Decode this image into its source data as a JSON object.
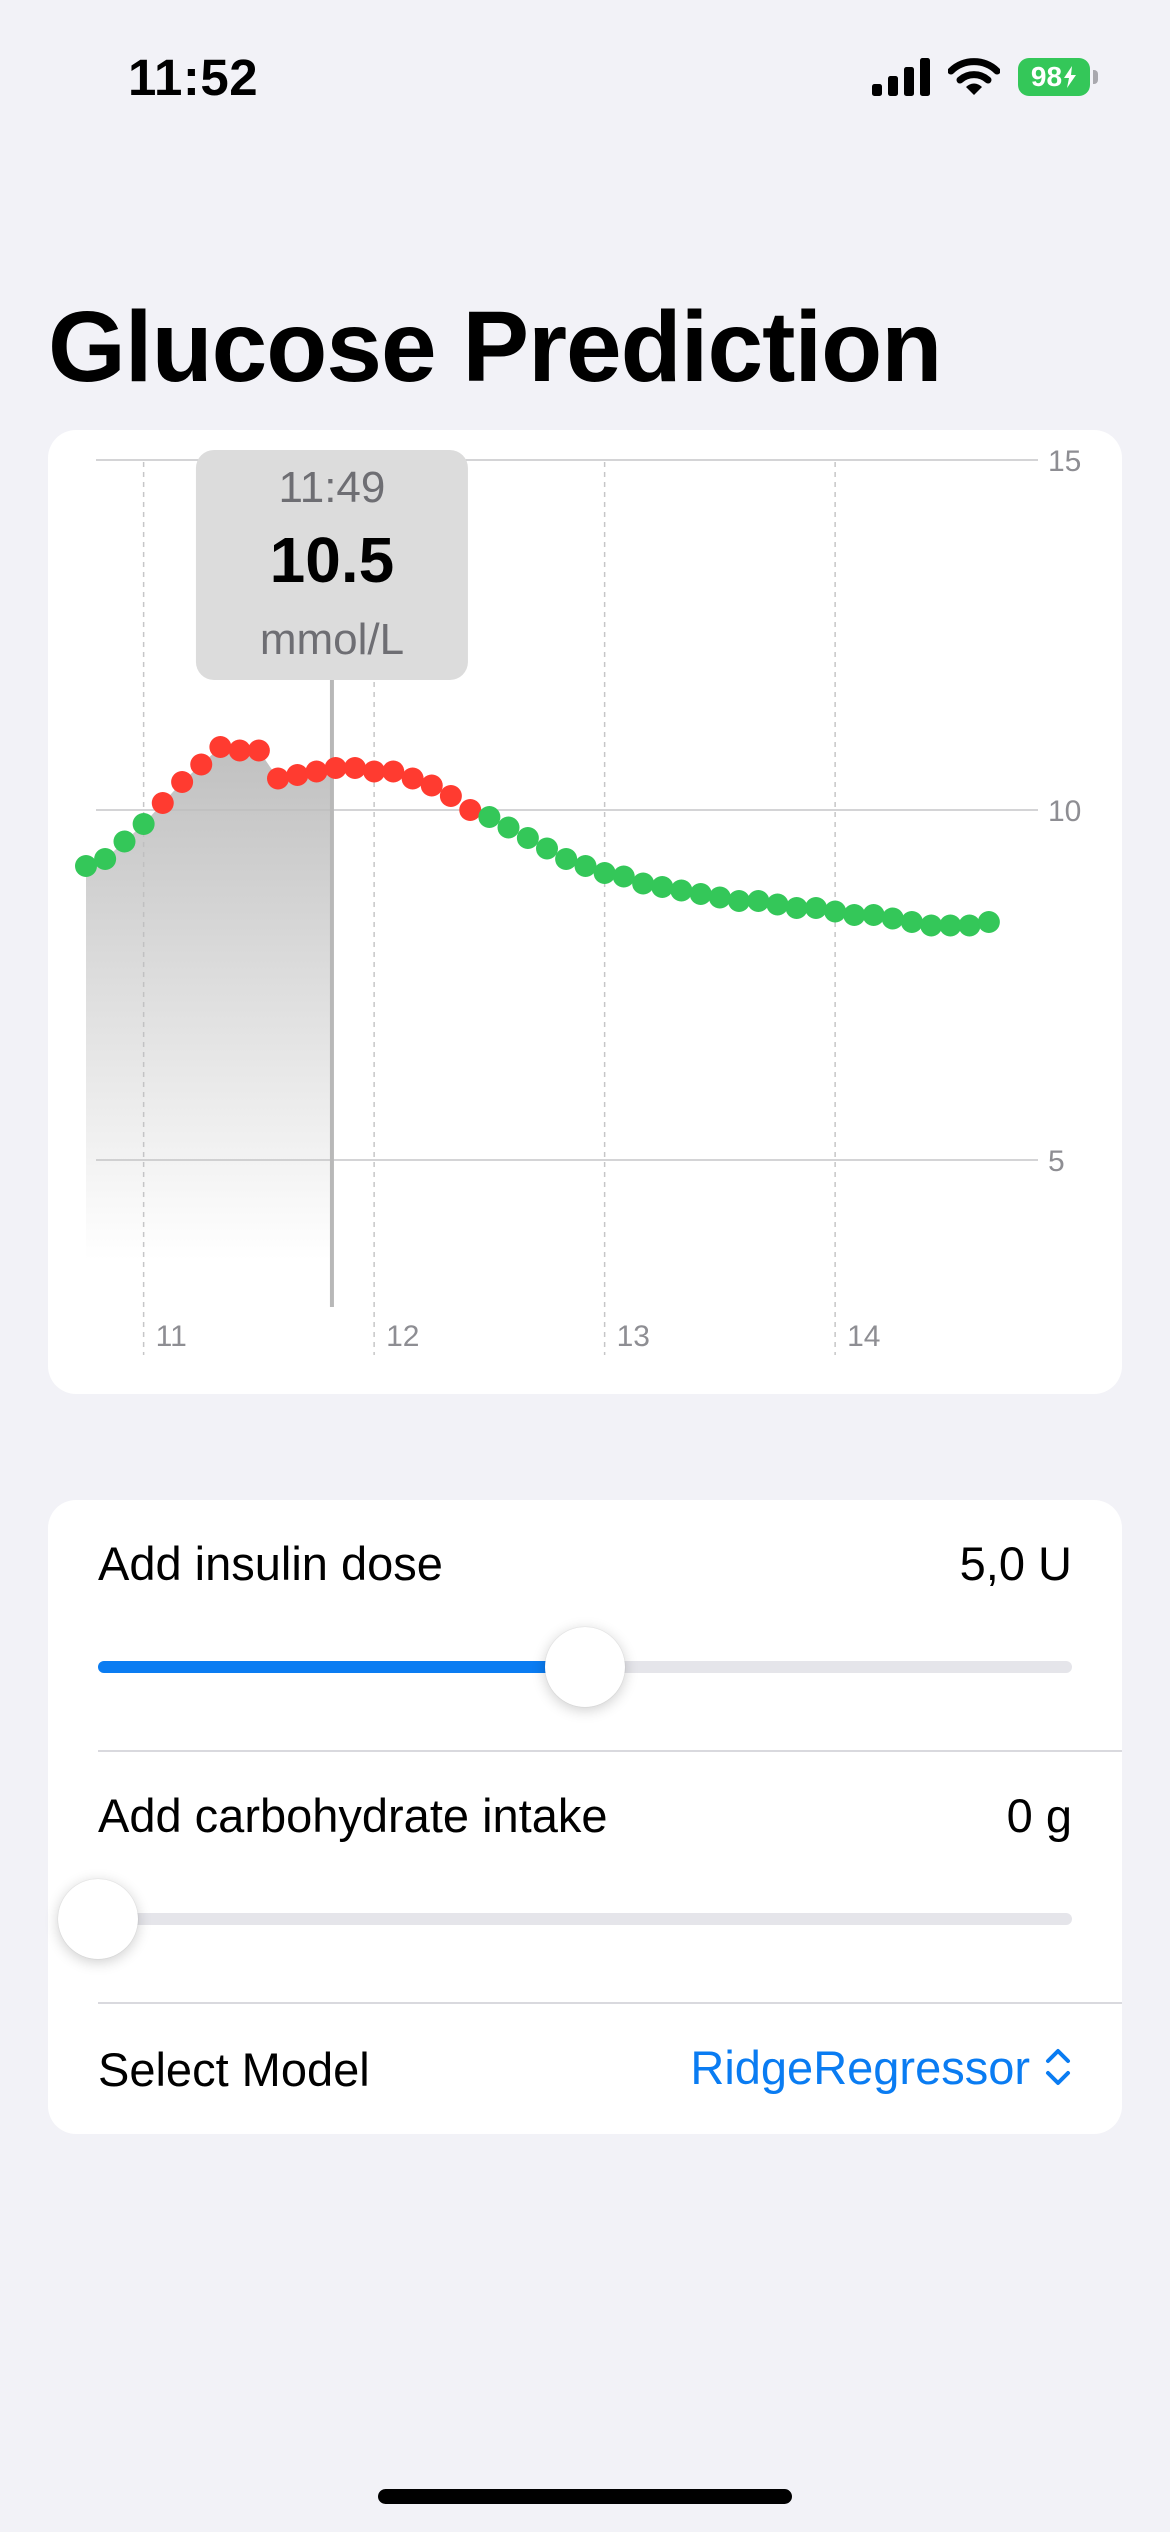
{
  "status_bar": {
    "time": "11:52",
    "battery_level": "98",
    "battery_color": "#34c759"
  },
  "page": {
    "title": "Glucose Prediction"
  },
  "chart_data": {
    "type": "scatter",
    "x_unit": "hour",
    "y_unit": "mmol/L",
    "xlim": [
      10.75,
      14.75
    ],
    "ylim": [
      2.0,
      15.0
    ],
    "y_ticks": [
      15,
      10,
      5
    ],
    "y_tick_labels": [
      "15",
      "10",
      "5"
    ],
    "x_ticks": [
      11,
      12,
      13,
      14
    ],
    "x_tick_labels": [
      "11",
      "12",
      "13",
      "14"
    ],
    "high_threshold": 10.0,
    "colors": {
      "in_range": "#34c759",
      "high": "#ff3b30",
      "area": "#bdbdbd",
      "selection_line": "#b8b8b8",
      "grid": "#c6c6c8"
    },
    "selected": {
      "time": "11:49",
      "value": "10.5",
      "unit": "mmol/L",
      "x": 11.817
    },
    "series": [
      {
        "points": [
          [
            10.75,
            9.2
          ],
          [
            10.833,
            9.3
          ],
          [
            10.917,
            9.55
          ],
          [
            11.0,
            9.8
          ],
          [
            11.083,
            10.1
          ],
          [
            11.167,
            10.4
          ],
          [
            11.25,
            10.65
          ],
          [
            11.333,
            10.9
          ],
          [
            11.417,
            10.85
          ],
          [
            11.5,
            10.85
          ],
          [
            11.583,
            10.45
          ],
          [
            11.667,
            10.5
          ],
          [
            11.75,
            10.55
          ],
          [
            11.833,
            10.6
          ],
          [
            11.917,
            10.6
          ],
          [
            12.0,
            10.55
          ],
          [
            12.083,
            10.55
          ],
          [
            12.167,
            10.45
          ],
          [
            12.25,
            10.35
          ],
          [
            12.333,
            10.2
          ],
          [
            12.417,
            10.0
          ],
          [
            12.5,
            9.9
          ],
          [
            12.583,
            9.75
          ],
          [
            12.667,
            9.6
          ],
          [
            12.75,
            9.45
          ],
          [
            12.833,
            9.3
          ],
          [
            12.917,
            9.2
          ],
          [
            13.0,
            9.1
          ],
          [
            13.083,
            9.05
          ],
          [
            13.167,
            8.95
          ],
          [
            13.25,
            8.9
          ],
          [
            13.333,
            8.85
          ],
          [
            13.417,
            8.8
          ],
          [
            13.5,
            8.75
          ],
          [
            13.583,
            8.7
          ],
          [
            13.667,
            8.7
          ],
          [
            13.75,
            8.65
          ],
          [
            13.833,
            8.6
          ],
          [
            13.917,
            8.6
          ],
          [
            14.0,
            8.55
          ],
          [
            14.083,
            8.5
          ],
          [
            14.167,
            8.5
          ],
          [
            14.25,
            8.45
          ],
          [
            14.333,
            8.4
          ],
          [
            14.417,
            8.35
          ],
          [
            14.5,
            8.35
          ],
          [
            14.583,
            8.35
          ],
          [
            14.667,
            8.4
          ]
        ]
      }
    ]
  },
  "controls": {
    "insulin": {
      "label": "Add insulin dose",
      "value": "5,0 U",
      "fraction": 0.5,
      "accent": "#0a7cf2"
    },
    "carbs": {
      "label": "Add carbohydrate intake",
      "value": "0 g",
      "fraction": 0.0
    },
    "model": {
      "label": "Select Model",
      "value": "RidgeRegressor",
      "color": "#0a7cf2",
      "icon": "chevron-up-down-icon"
    }
  }
}
